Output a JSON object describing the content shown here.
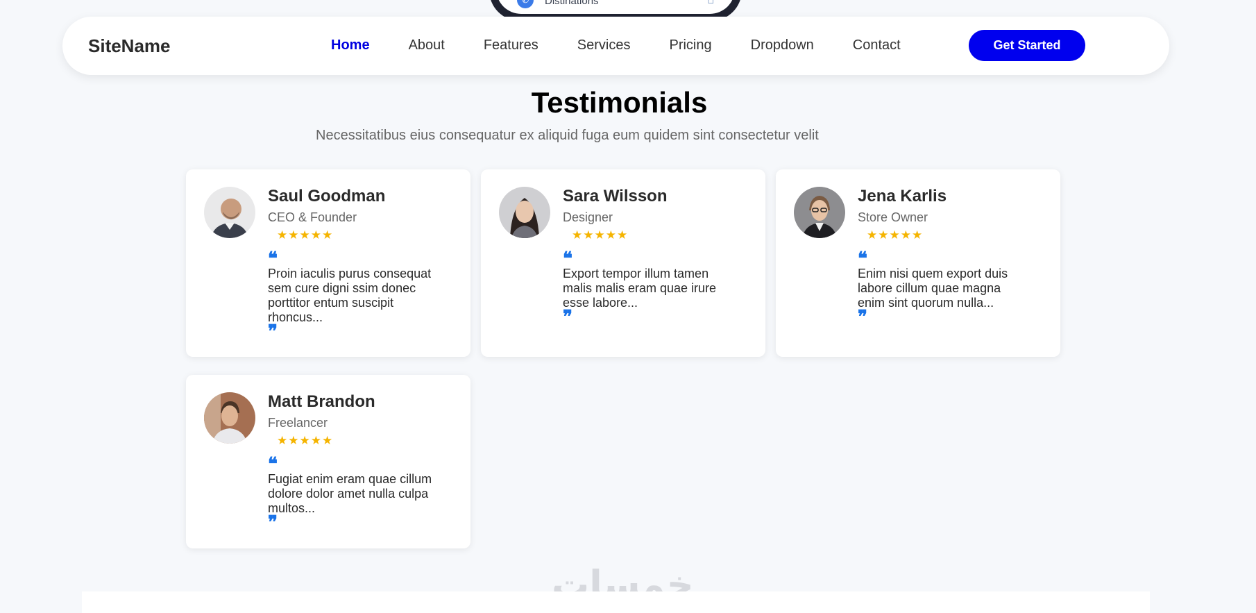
{
  "phone": {
    "label": "Distinations",
    "dial_icon": "phone-icon",
    "house_icon": "house-icon"
  },
  "nav": {
    "brand": "SiteName",
    "links": [
      "Home",
      "About",
      "Features",
      "Services",
      "Pricing",
      "Dropdown",
      "Contact"
    ],
    "active": "Home",
    "cta": "Get Started"
  },
  "section": {
    "title": "Testimonials",
    "subtitle": "Necessitatibus eius consequatur ex aliquid fuga eum quidem sint consectetur velit"
  },
  "testimonials": [
    {
      "name": "Saul Goodman",
      "role": "CEO & Founder",
      "stars": "★★★★★",
      "quote_open": "❝",
      "text": "Proin iaculis purus consequat sem cure digni ssim donec porttitor entum suscipit rhoncus...",
      "quote_close": "❞"
    },
    {
      "name": "Sara Wilsson",
      "role": "Designer",
      "stars": "★★★★★",
      "quote_open": "❝",
      "text": "Export tempor illum tamen malis malis eram quae irure esse labore...",
      "quote_close": "❞"
    },
    {
      "name": "Jena Karlis",
      "role": "Store Owner",
      "stars": "★★★★★",
      "quote_open": "❝",
      "text": "Enim nisi quem export duis labore cillum quae magna enim sint quorum nulla...",
      "quote_close": "❞"
    },
    {
      "name": "Matt Brandon",
      "role": "Freelancer",
      "stars": "★★★★★",
      "quote_open": "❝",
      "text": "Fugiat enim eram quae cillum dolore dolor amet nulla culpa multos...",
      "quote_close": "❞"
    }
  ],
  "watermark": "خمسات",
  "colors": {
    "accent": "#0000ee",
    "star": "#f5b400",
    "quote": "#1a73e8",
    "background": "#f6f8fb"
  }
}
